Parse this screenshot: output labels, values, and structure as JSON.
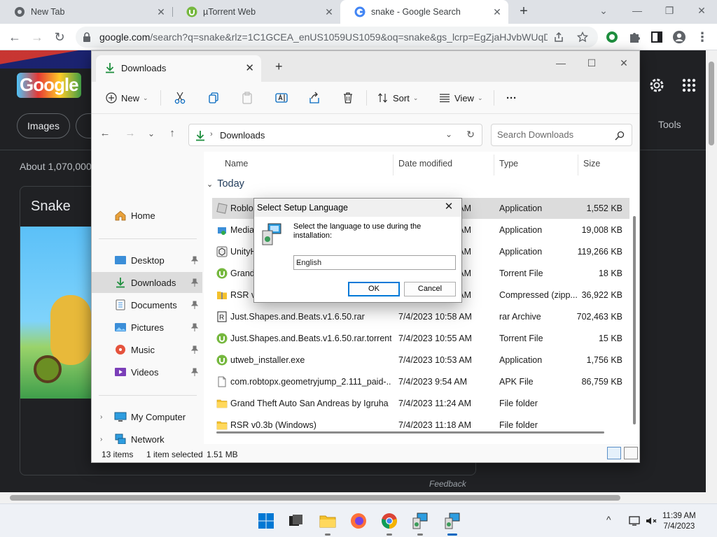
{
  "browser": {
    "tabs": [
      {
        "label": "New Tab",
        "active": false
      },
      {
        "label": "µTorrent Web",
        "active": false
      },
      {
        "label": "snake - Google Search",
        "active": true
      }
    ],
    "url_domain": "google.com",
    "url_path": "/search?q=snake&rlz=1C1GCEA_enUS1059US1059&oq=snake&gs_lcrp=EgZjaHJvbWUqD..."
  },
  "google": {
    "images_chip": "Images",
    "about": "About 1,070,000",
    "card_title": "Snake",
    "tools": "Tools",
    "feedback": "Feedback"
  },
  "explorer": {
    "tab_label": "Downloads",
    "cmd": {
      "new": "New",
      "sort": "Sort",
      "view": "View",
      "more": "···"
    },
    "address": "Downloads",
    "search_placeholder": "Search Downloads",
    "sidebar": {
      "home": "Home",
      "pinned": [
        "Desktop",
        "Downloads",
        "Documents",
        "Pictures",
        "Music",
        "Videos"
      ],
      "my_computer": "My Computer",
      "network": "Network"
    },
    "columns": {
      "name": "Name",
      "date": "Date modified",
      "type": "Type",
      "size": "Size"
    },
    "group": "Today",
    "files": [
      {
        "name": "Roblox",
        "date": "7/4/2023 11:38 AM",
        "type": "Application",
        "size": "1,552 KB",
        "icon": "roblox-icon",
        "selected": true
      },
      {
        "name": "MediaCreationTool",
        "date": "7/4/2023 11:36 AM",
        "type": "Application",
        "size": "19,008 KB",
        "icon": "media-tool-icon"
      },
      {
        "name": "UnityHubSetup",
        "date": "7/4/2023 11:30 AM",
        "type": "Application",
        "size": "119,266 KB",
        "icon": "unity-icon"
      },
      {
        "name": "Grand Theft Auto San Andreas",
        "date": "7/4/2023 11:26 AM",
        "type": "Torrent File",
        "size": "18 KB",
        "icon": "torrent-icon"
      },
      {
        "name": "RSR v0.3b (Windows)",
        "date": "7/4/2023 11:18 AM",
        "type": "Compressed (zipp...",
        "size": "36,922 KB",
        "icon": "zip-folder-icon"
      },
      {
        "name": "Just.Shapes.and.Beats.v1.6.50.rar",
        "date": "7/4/2023 10:58 AM",
        "type": "rar Archive",
        "size": "702,463 KB",
        "icon": "rar-icon"
      },
      {
        "name": "Just.Shapes.and.Beats.v1.6.50.rar.torrent",
        "date": "7/4/2023 10:55 AM",
        "type": "Torrent File",
        "size": "15 KB",
        "icon": "torrent-icon"
      },
      {
        "name": "utweb_installer.exe",
        "date": "7/4/2023 10:53 AM",
        "type": "Application",
        "size": "1,756 KB",
        "icon": "torrent-icon"
      },
      {
        "name": "com.robtopx.geometryjump_2.111_paid-...",
        "date": "7/4/2023 9:54 AM",
        "type": "APK File",
        "size": "86,759 KB",
        "icon": "file-icon"
      },
      {
        "name": "Grand Theft Auto San Andreas by Igruha",
        "date": "7/4/2023 11:24 AM",
        "type": "File folder",
        "size": "",
        "icon": "folder-icon"
      },
      {
        "name": "RSR v0.3b (Windows)",
        "date": "7/4/2023 11:18 AM",
        "type": "File folder",
        "size": "",
        "icon": "folder-icon"
      }
    ],
    "status": {
      "items": "13 items",
      "selected": "1 item selected",
      "size": "1.51 MB"
    }
  },
  "dialog": {
    "title": "Select Setup Language",
    "message": "Select the language to use during the installation:",
    "language": "English",
    "ok": "OK",
    "cancel": "Cancel"
  },
  "taskbar": {
    "time": "11:39 AM",
    "date": "7/4/2023"
  },
  "colors": {
    "accent": "#0067c0",
    "dialog_ok_border": "#0078d7"
  }
}
